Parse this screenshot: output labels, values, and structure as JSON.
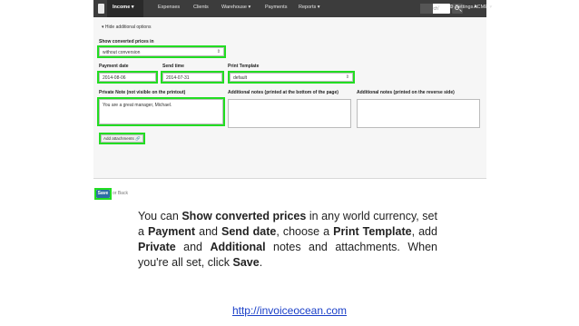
{
  "topbar": {
    "nav": [
      {
        "label": "Income ▾",
        "active": true
      },
      {
        "label": "Expenses"
      },
      {
        "label": "Clients"
      },
      {
        "label": "Warehouse ▾"
      },
      {
        "label": "Payments"
      },
      {
        "label": "Reports ▾"
      }
    ],
    "search_placeholder": "Search",
    "account": "ACME ▾",
    "settings": "⚙ Settings ▾"
  },
  "panel": {
    "hide_options": "▾ Hide additional options",
    "converted": {
      "label": "Show converted prices in",
      "value": "without conversion"
    },
    "payment_date": {
      "label": "Payment date",
      "value": "2014-08-06"
    },
    "send_time": {
      "label": "Send time",
      "value": "2014-07-31"
    },
    "print_template": {
      "label": "Print Template",
      "value": "default"
    },
    "private_note": {
      "label": "Private Note (not visible on the printout)",
      "value": "You are a great manager, Michael."
    },
    "notes_bottom": {
      "label": "Additional notes (printed at the bottom of the page)"
    },
    "notes_reverse": {
      "label": "Additional notes (printed on the reverse side)"
    },
    "add_attachments": "Add attachments 🔗"
  },
  "footer": {
    "save": "Save",
    "back": "or Back"
  },
  "description": {
    "p1": "You can ",
    "b1": "Show converted prices",
    "p2": " in any world currency, set a ",
    "b2": "Payment",
    "p3": " and ",
    "b3": "Send date",
    "p4": ", choose a ",
    "b4": "Print Template",
    "p5": ", add ",
    "b5": "Private",
    "p6": " and ",
    "b6": "Additional",
    "p7": " notes and attachments. When you're all set, click ",
    "b7": "Save",
    "p8": "."
  },
  "url": "http://invoiceocean.com",
  "colors": {
    "highlight": "#22dd22",
    "topbar": "#3c3c3c",
    "save": "#2e6da4",
    "link": "#1a3fc8"
  }
}
